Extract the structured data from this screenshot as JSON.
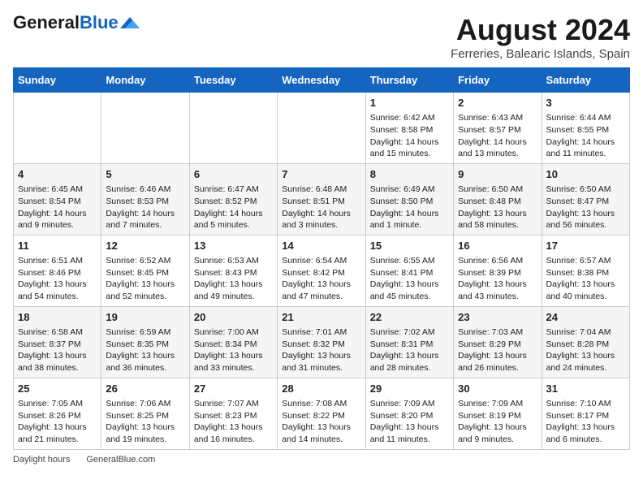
{
  "header": {
    "logo_general": "General",
    "logo_blue": "Blue",
    "title": "August 2024",
    "subtitle": "Ferreries, Balearic Islands, Spain"
  },
  "days_of_week": [
    "Sunday",
    "Monday",
    "Tuesday",
    "Wednesday",
    "Thursday",
    "Friday",
    "Saturday"
  ],
  "weeks": [
    [
      {
        "num": "",
        "info": ""
      },
      {
        "num": "",
        "info": ""
      },
      {
        "num": "",
        "info": ""
      },
      {
        "num": "",
        "info": ""
      },
      {
        "num": "1",
        "info": "Sunrise: 6:42 AM\nSunset: 8:58 PM\nDaylight: 14 hours and 15 minutes."
      },
      {
        "num": "2",
        "info": "Sunrise: 6:43 AM\nSunset: 8:57 PM\nDaylight: 14 hours and 13 minutes."
      },
      {
        "num": "3",
        "info": "Sunrise: 6:44 AM\nSunset: 8:55 PM\nDaylight: 14 hours and 11 minutes."
      }
    ],
    [
      {
        "num": "4",
        "info": "Sunrise: 6:45 AM\nSunset: 8:54 PM\nDaylight: 14 hours and 9 minutes."
      },
      {
        "num": "5",
        "info": "Sunrise: 6:46 AM\nSunset: 8:53 PM\nDaylight: 14 hours and 7 minutes."
      },
      {
        "num": "6",
        "info": "Sunrise: 6:47 AM\nSunset: 8:52 PM\nDaylight: 14 hours and 5 minutes."
      },
      {
        "num": "7",
        "info": "Sunrise: 6:48 AM\nSunset: 8:51 PM\nDaylight: 14 hours and 3 minutes."
      },
      {
        "num": "8",
        "info": "Sunrise: 6:49 AM\nSunset: 8:50 PM\nDaylight: 14 hours and 1 minute."
      },
      {
        "num": "9",
        "info": "Sunrise: 6:50 AM\nSunset: 8:48 PM\nDaylight: 13 hours and 58 minutes."
      },
      {
        "num": "10",
        "info": "Sunrise: 6:50 AM\nSunset: 8:47 PM\nDaylight: 13 hours and 56 minutes."
      }
    ],
    [
      {
        "num": "11",
        "info": "Sunrise: 6:51 AM\nSunset: 8:46 PM\nDaylight: 13 hours and 54 minutes."
      },
      {
        "num": "12",
        "info": "Sunrise: 6:52 AM\nSunset: 8:45 PM\nDaylight: 13 hours and 52 minutes."
      },
      {
        "num": "13",
        "info": "Sunrise: 6:53 AM\nSunset: 8:43 PM\nDaylight: 13 hours and 49 minutes."
      },
      {
        "num": "14",
        "info": "Sunrise: 6:54 AM\nSunset: 8:42 PM\nDaylight: 13 hours and 47 minutes."
      },
      {
        "num": "15",
        "info": "Sunrise: 6:55 AM\nSunset: 8:41 PM\nDaylight: 13 hours and 45 minutes."
      },
      {
        "num": "16",
        "info": "Sunrise: 6:56 AM\nSunset: 8:39 PM\nDaylight: 13 hours and 43 minutes."
      },
      {
        "num": "17",
        "info": "Sunrise: 6:57 AM\nSunset: 8:38 PM\nDaylight: 13 hours and 40 minutes."
      }
    ],
    [
      {
        "num": "18",
        "info": "Sunrise: 6:58 AM\nSunset: 8:37 PM\nDaylight: 13 hours and 38 minutes."
      },
      {
        "num": "19",
        "info": "Sunrise: 6:59 AM\nSunset: 8:35 PM\nDaylight: 13 hours and 36 minutes."
      },
      {
        "num": "20",
        "info": "Sunrise: 7:00 AM\nSunset: 8:34 PM\nDaylight: 13 hours and 33 minutes."
      },
      {
        "num": "21",
        "info": "Sunrise: 7:01 AM\nSunset: 8:32 PM\nDaylight: 13 hours and 31 minutes."
      },
      {
        "num": "22",
        "info": "Sunrise: 7:02 AM\nSunset: 8:31 PM\nDaylight: 13 hours and 28 minutes."
      },
      {
        "num": "23",
        "info": "Sunrise: 7:03 AM\nSunset: 8:29 PM\nDaylight: 13 hours and 26 minutes."
      },
      {
        "num": "24",
        "info": "Sunrise: 7:04 AM\nSunset: 8:28 PM\nDaylight: 13 hours and 24 minutes."
      }
    ],
    [
      {
        "num": "25",
        "info": "Sunrise: 7:05 AM\nSunset: 8:26 PM\nDaylight: 13 hours and 21 minutes."
      },
      {
        "num": "26",
        "info": "Sunrise: 7:06 AM\nSunset: 8:25 PM\nDaylight: 13 hours and 19 minutes."
      },
      {
        "num": "27",
        "info": "Sunrise: 7:07 AM\nSunset: 8:23 PM\nDaylight: 13 hours and 16 minutes."
      },
      {
        "num": "28",
        "info": "Sunrise: 7:08 AM\nSunset: 8:22 PM\nDaylight: 13 hours and 14 minutes."
      },
      {
        "num": "29",
        "info": "Sunrise: 7:09 AM\nSunset: 8:20 PM\nDaylight: 13 hours and 11 minutes."
      },
      {
        "num": "30",
        "info": "Sunrise: 7:09 AM\nSunset: 8:19 PM\nDaylight: 13 hours and 9 minutes."
      },
      {
        "num": "31",
        "info": "Sunrise: 7:10 AM\nSunset: 8:17 PM\nDaylight: 13 hours and 6 minutes."
      }
    ]
  ],
  "footer": {
    "daylight_label": "Daylight hours",
    "source": "GeneralBlue.com"
  }
}
